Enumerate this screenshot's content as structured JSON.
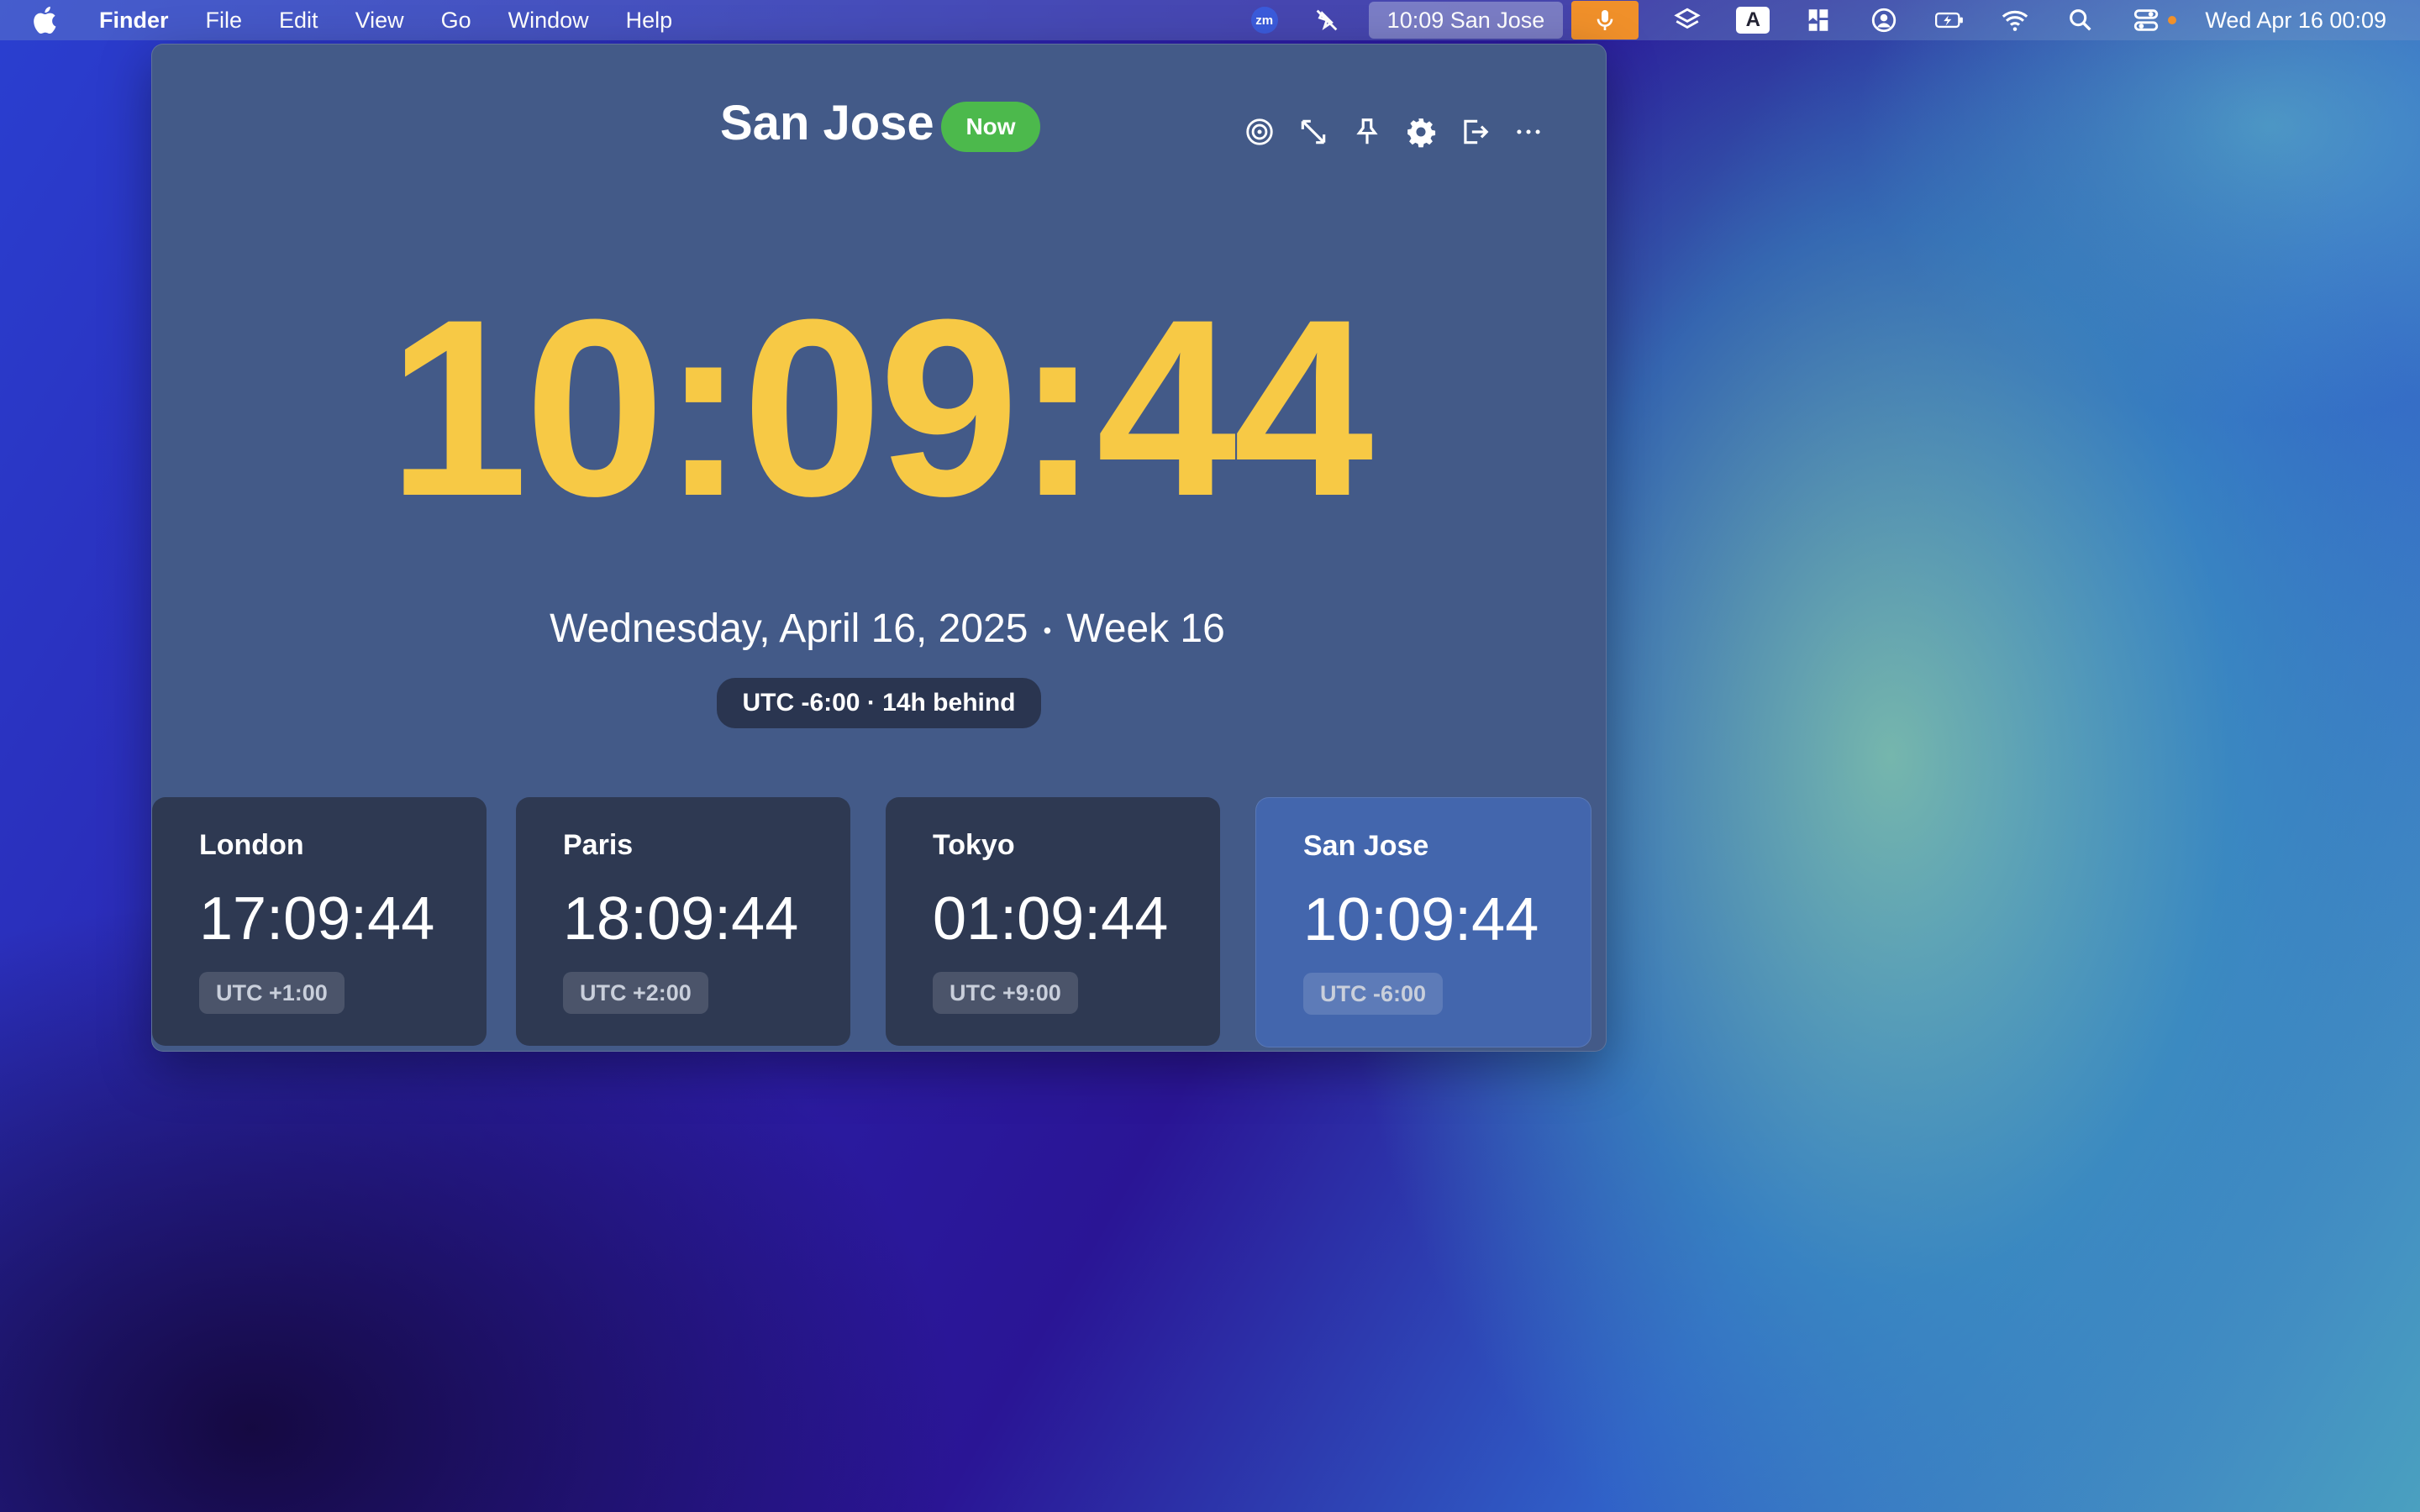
{
  "menubar": {
    "app_name": "Finder",
    "menus": [
      "File",
      "Edit",
      "View",
      "Go",
      "Window",
      "Help"
    ],
    "zoom_label": "zm",
    "clock_widget": "10:09 San Jose",
    "input_label": "A",
    "datetime": "Wed Apr 16  00:09"
  },
  "window": {
    "city": "San Jose",
    "now_badge": "Now",
    "time": "10:09:44",
    "date": "Wednesday, April 16, 2025",
    "week": "Week 16",
    "separator": "•",
    "utc_info": "UTC -6:00 · 14h behind"
  },
  "cards": [
    {
      "city": "London",
      "time": "17:09:44",
      "utc": "UTC +1:00"
    },
    {
      "city": "Paris",
      "time": "18:09:44",
      "utc": "UTC +2:00"
    },
    {
      "city": "Tokyo",
      "time": "01:09:44",
      "utc": "UTC +9:00"
    },
    {
      "city": "San Jose",
      "time": "10:09:44",
      "utc": "UTC -6:00"
    }
  ],
  "colors": {
    "accent_time": "#f7c945",
    "now_badge": "#4cb94c",
    "window_bg": "#435a88",
    "card_bg": "#2e3952",
    "active_card_bg": "#4366ad",
    "mic_active": "#f0902a"
  },
  "icons": {
    "toolbar": [
      "target-icon",
      "resize-icon",
      "pin-icon",
      "gear-icon",
      "export-icon",
      "more-icon"
    ]
  }
}
